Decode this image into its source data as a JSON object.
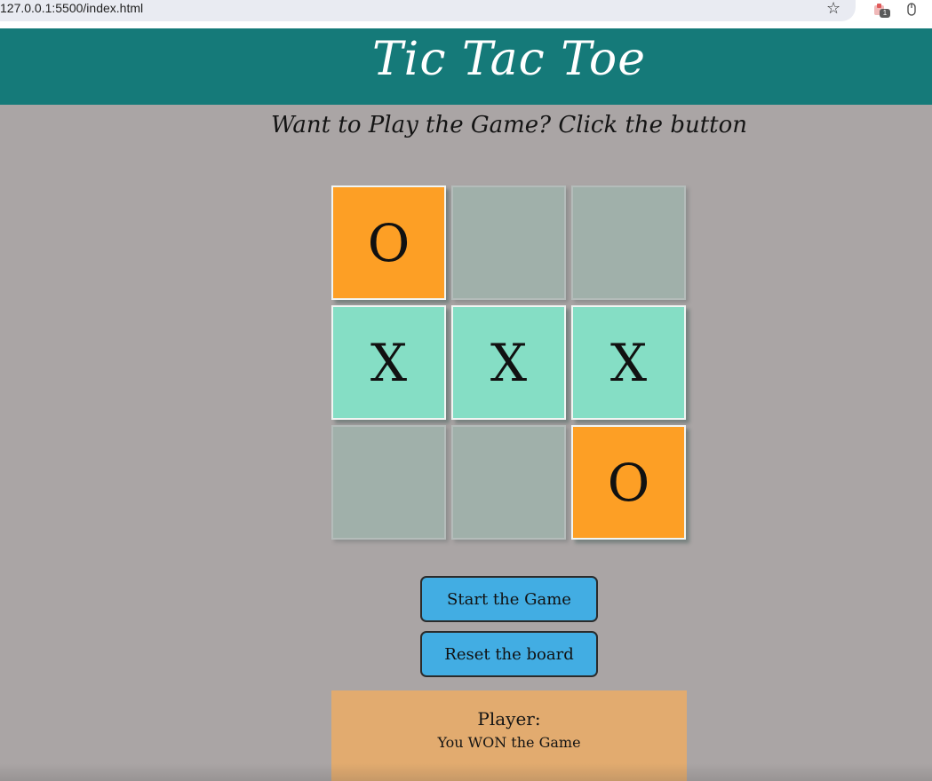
{
  "browser": {
    "url": "127.0.0.1:5500/index.html",
    "bookmark_icon": "star-icon",
    "extension_icon": "extension-icon",
    "extension_badge": "1",
    "mouse_icon": "mouse-icon"
  },
  "header": {
    "title": "Tic Tac Toe",
    "background": "#157a79"
  },
  "subtitle": "Want to Play the Game? Click the button",
  "board": {
    "cells": [
      "O",
      "",
      "",
      "X",
      "X",
      "X",
      "",
      "",
      "O"
    ]
  },
  "buttons": {
    "start_label": "Start the Game",
    "reset_label": "Reset the board",
    "color": "#42ade3"
  },
  "status": {
    "player_label": "Player:",
    "message": "You WON the Game"
  },
  "colors": {
    "page_background": "#aaa5a5",
    "x_cell": "#85dec5",
    "o_cell": "#fd9f25",
    "empty_cell": "#a0b0aa",
    "status_panel": "#e2ab6f"
  }
}
